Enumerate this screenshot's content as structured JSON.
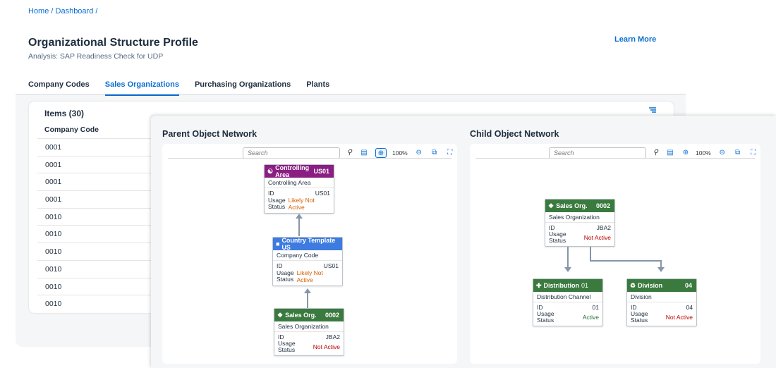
{
  "breadcrumb": "Home / Dashboard /",
  "page": {
    "title": "Organizational Structure Profile",
    "subtitle": "Analysis: SAP Readiness Check for UDP",
    "learn_more": "Learn More"
  },
  "tabs": [
    {
      "label": "Company Codes"
    },
    {
      "label": "Sales Organizations",
      "active": true
    },
    {
      "label": "Purchasing Organizations"
    },
    {
      "label": "Plants"
    }
  ],
  "items": {
    "title": "Items (30)",
    "column": "Company Code",
    "rows": [
      "0001",
      "0001",
      "0001",
      "0001",
      "0010",
      "0010",
      "0010",
      "0010",
      "0010",
      "0010"
    ]
  },
  "parent_network": {
    "title": "Parent Object Network",
    "search_placeholder": "Search",
    "zoom": "100%",
    "nodes": [
      {
        "header": "Controlling Area",
        "code": "US01",
        "color": "#8b1e82",
        "icon": "controlling-area-icon",
        "type": "Controlling Area",
        "id_label": "ID",
        "id": "US01",
        "usage_label": "Usage Status",
        "status": "Likely Not Active",
        "status_kind": "likely"
      },
      {
        "header": "Country Template US",
        "code": "",
        "color": "#3d7be0",
        "icon": "company-code-icon",
        "type": "Company Code",
        "id_label": "ID",
        "id": "US01",
        "usage_label": "Usage Status",
        "status": "Likely Not Active",
        "status_kind": "likely"
      },
      {
        "header": "Sales Org.",
        "code": "0002",
        "color": "#3a7a3f",
        "icon": "sales-org-icon",
        "type": "Sales Organization",
        "id_label": "ID",
        "id": "JBA2",
        "usage_label": "Usage Status",
        "status": "Not Active",
        "status_kind": "not"
      }
    ]
  },
  "child_network": {
    "title": "Child Object Network",
    "search_placeholder": "Search",
    "zoom": "100%",
    "nodes": [
      {
        "header": "Sales Org.",
        "code": "0002",
        "color": "#3a7a3f",
        "icon": "sales-org-icon",
        "type": "Sales Organization",
        "id_label": "ID",
        "id": "JBA2",
        "usage_label": "Usage Status",
        "status": "Not Active",
        "status_kind": "not"
      },
      {
        "header": "Distribution",
        "code": "01",
        "color": "#3a7a3f",
        "icon": "distribution-icon",
        "type": "Distribution Channel",
        "id_label": "ID",
        "id": "01",
        "usage_label": "Usage Status",
        "status": "Active",
        "status_kind": "active"
      },
      {
        "header": "Division",
        "code": "04",
        "color": "#3a7a3f",
        "icon": "division-icon",
        "type": "Division",
        "id_label": "ID",
        "id": "04",
        "usage_label": "Usage Status",
        "status": "Not Active",
        "status_kind": "not"
      }
    ]
  }
}
